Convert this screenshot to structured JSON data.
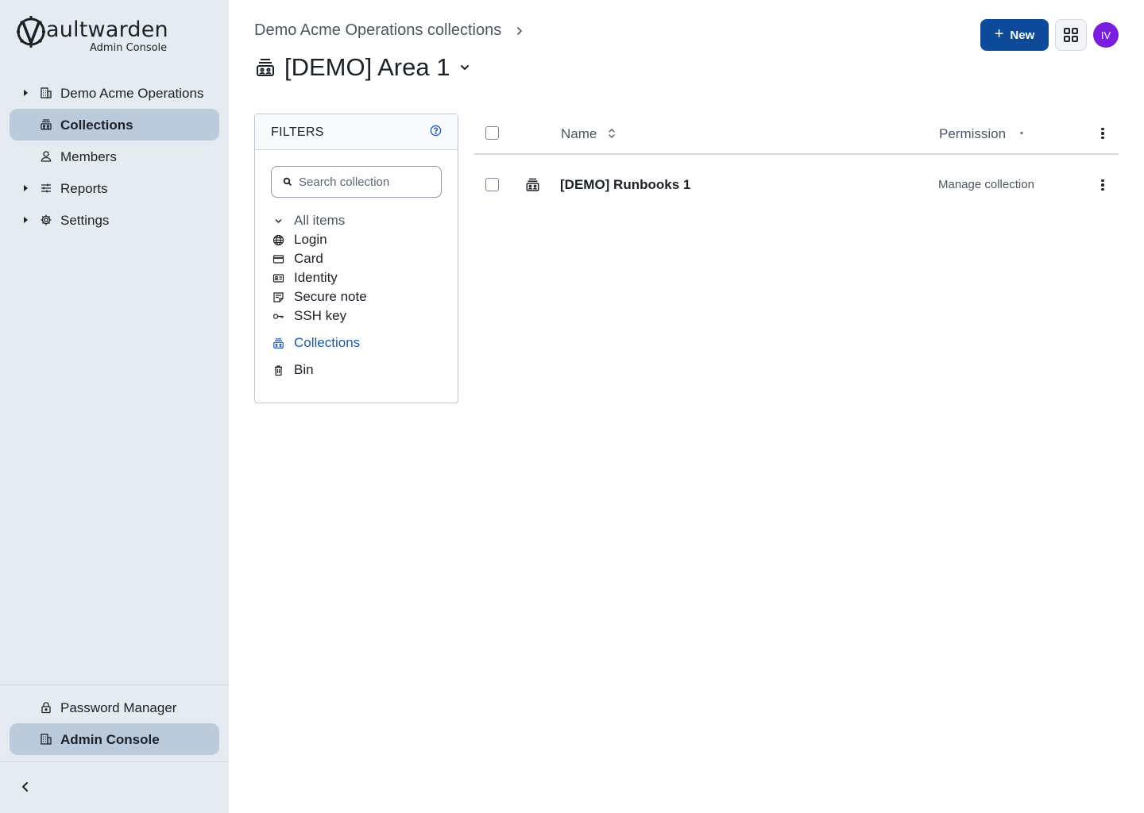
{
  "app": {
    "logo_word": "aultwarden",
    "logo_subtitle": "Admin Console"
  },
  "sidebar": {
    "items": [
      {
        "label": "Demo Acme Operations",
        "icon": "building-icon",
        "expandable": true,
        "active": false
      },
      {
        "label": "Collections",
        "icon": "collection-icon",
        "expandable": false,
        "active": true
      },
      {
        "label": "Members",
        "icon": "user-icon",
        "expandable": false,
        "active": false
      },
      {
        "label": "Reports",
        "icon": "sliders-icon",
        "expandable": true,
        "active": false
      },
      {
        "label": "Settings",
        "icon": "gear-icon",
        "expandable": true,
        "active": false
      }
    ],
    "bottom_items": [
      {
        "label": "Password Manager",
        "icon": "lock-icon",
        "active": false
      },
      {
        "label": "Admin Console",
        "icon": "building-icon",
        "active": true
      }
    ]
  },
  "header": {
    "breadcrumb": "Demo Acme Operations collections",
    "title": "[DEMO] Area 1",
    "new_label": "New",
    "avatar_initials": "IV",
    "avatar_color": "#7a1ede",
    "accent_color": "#0e4a9a"
  },
  "filters": {
    "title": "FILTERS",
    "search_placeholder": "Search collection",
    "search_value": "",
    "all_items": "All items",
    "types": [
      {
        "label": "Login",
        "icon": "globe-icon"
      },
      {
        "label": "Card",
        "icon": "credit-card-icon"
      },
      {
        "label": "Identity",
        "icon": "id-card-icon"
      },
      {
        "label": "Secure note",
        "icon": "note-icon"
      },
      {
        "label": "SSH key",
        "icon": "key-icon"
      }
    ],
    "collections": "Collections",
    "bin": "Bin"
  },
  "table": {
    "columns": {
      "name": "Name",
      "permission": "Permission"
    },
    "rows": [
      {
        "name": "[DEMO] Runbooks 1",
        "permission": "Manage collection",
        "icon": "collection-icon"
      }
    ]
  }
}
